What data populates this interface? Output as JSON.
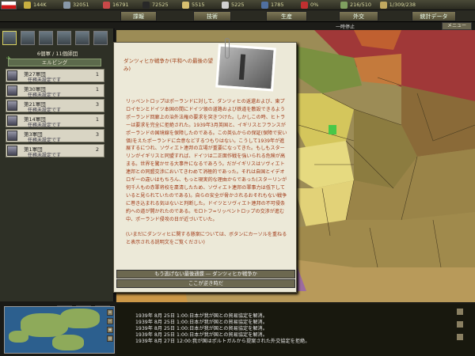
{
  "resources": [
    {
      "icon": "energy-icon",
      "value": "144K",
      "color": "#c8b040"
    },
    {
      "icon": "metal-icon",
      "value": "32051",
      "color": "#8898a8"
    },
    {
      "icon": "rare-material-icon",
      "value": "16791",
      "color": "#c84848"
    },
    {
      "icon": "oil-icon",
      "value": "72525",
      "color": "#282828"
    },
    {
      "icon": "supplies-icon",
      "value": "5515",
      "color": "#d8c070"
    },
    {
      "icon": "money-icon",
      "value": "5225",
      "color": "#d0d0d0"
    },
    {
      "icon": "transport-icon",
      "value": "1785",
      "color": "#5070a0"
    },
    {
      "icon": "dissent-icon",
      "value": "0%",
      "color": "#c03030"
    },
    {
      "icon": "manpower-icon",
      "value": "216/510",
      "color": "#80a060"
    },
    {
      "icon": "date-icon",
      "value": "1/309/238",
      "color": "#c0a860"
    }
  ],
  "menu": [
    "諜報",
    "技術",
    "生産",
    "外交",
    "統計データ"
  ],
  "status": {
    "pause": "一時停止",
    "sysmenu": "メニュー"
  },
  "army": {
    "title": "6個軍 / 11個師団",
    "group": "エルビング",
    "units": [
      {
        "name": "第27軍団",
        "status": "任務未設定です",
        "count": "1"
      },
      {
        "name": "第30軍団",
        "status": "任務未設定です",
        "count": "1"
      },
      {
        "name": "第21軍団",
        "status": "任務未設定です",
        "count": "3"
      },
      {
        "name": "第14軍団",
        "status": "任務未設定です",
        "count": "1"
      },
      {
        "name": "第3軍団",
        "status": "任務未設定です",
        "count": "3"
      },
      {
        "name": "第1軍団",
        "status": "任務未設定です",
        "count": "2"
      }
    ]
  },
  "event": {
    "title": "ダンツィヒか戦争か(平和への最後の望み)",
    "body": "リッベントロップはポーランドに対して、ダンツィヒの返還および、東プロイセンとドイツ本国の間にドイツ領の道路および鉄道を敷設できるようポーランド回廊上の治外法権の要求を突きつけた。しかしこの時、ヒトラーは要求を完全に拒絶された。1939年3月英国と、イギリスとフランスがポーランドの国境線を保障したのである。この英仏からの保証(保障で安い価)をえたポーランドに合意などするつもりはない。こうして1939年が進展するにつれ、ソヴィエト連邦の立場が重要になってきた。もしもスターリンがイギリスと同盟すれば、ドイツは二正面作戦を強いられる危険が高まる。世界を驚かせる大事件になるであろう。だがイギリスはソヴィエト連邦との同盟交渉においてきわめて消極的であった。それは自国とイデオロギーの違いはもちろん、もっと現実的な理由からであった(スターリンが何千人もの赤軍将校を粛清したため、ソヴィエト連邦の軍事力は低下していると見られていたのである)。自らの安全が脅かされるおそれもない戦争に巻き込まれる気はないと判断した。ドイツとソヴィエト連邦の不可侵条約への道が開かれたのである。モロトフ=リッベントロップの交渉が進む中、ポーランド侵攻の日が近づいていた。",
    "footnote": "(いまだにダンツィヒに関する懸案については、ボタンにカーソルを重ねると表示される説明文をご覧ください)",
    "option": "もう逃げない最後通牒 ― ダンツィヒか戦争か",
    "location": "ここが逆き時だ"
  },
  "log": [
    "1939年 8月 25日 1:00:日本が我が国との貿易協定を解消。",
    "1939年 8月 25日 1:00:日本が我が国との貿易協定を解消。",
    "1939年 8月 25日 1:00:日本が我が国との貿易協定を解消。",
    "1939年 8月 25日 1:00:日本が我が国との貿易協定を解消。",
    "1939年 8月 27日 12:00:我が国はポルトガルから提案された外交協定を拒絶。"
  ]
}
